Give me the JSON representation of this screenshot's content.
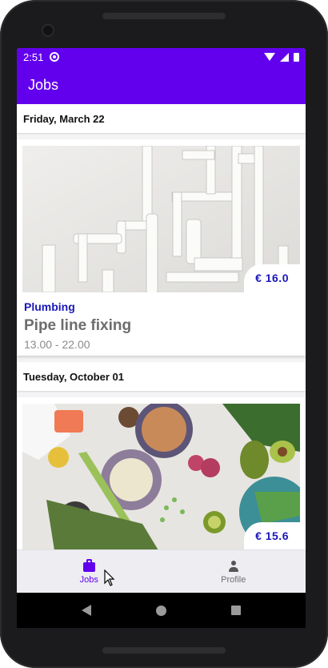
{
  "status_bar": {
    "time": "2:51"
  },
  "app_bar": {
    "title": "Jobs"
  },
  "sections": [
    {
      "date": "Friday, March 22",
      "job": {
        "category": "Plumbing",
        "title": "Pipe line fixing",
        "hours": "13.00 - 22.00",
        "price": "€ 16.0"
      }
    },
    {
      "date": "Tuesday, October 01",
      "job": {
        "price": "€ 15.6"
      }
    }
  ],
  "bottom_nav": {
    "items": [
      {
        "label": "Jobs",
        "icon": "briefcase-icon",
        "active": true
      },
      {
        "label": "Profile",
        "icon": "person-icon",
        "active": false
      }
    ]
  },
  "colors": {
    "primary": "#6200ee",
    "accent_text": "#1a18b8"
  }
}
